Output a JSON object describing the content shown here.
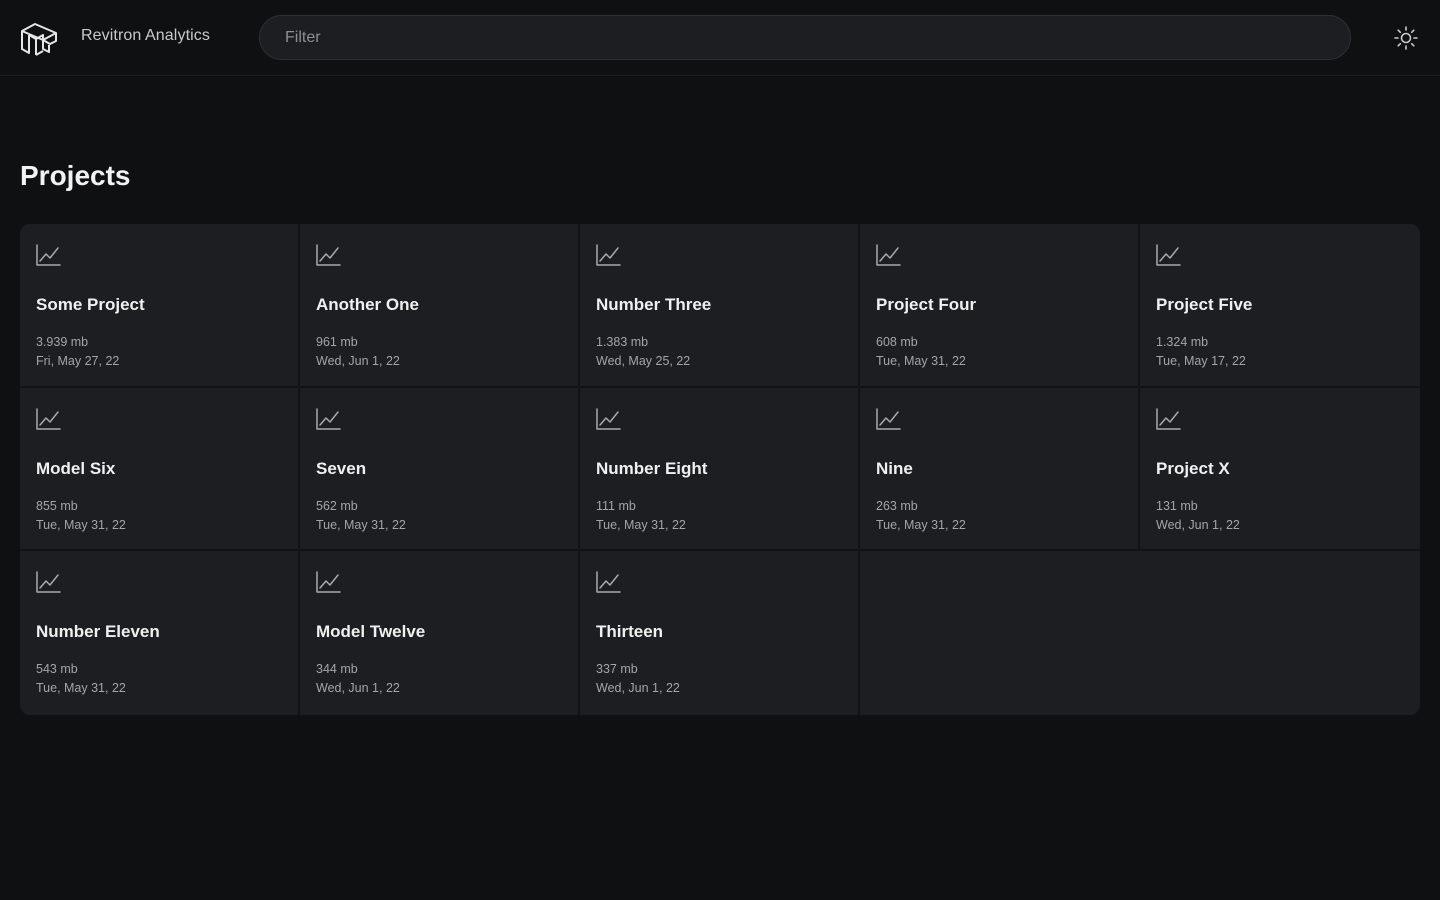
{
  "header": {
    "app_title": "Revitron Analytics",
    "filter_placeholder": "Filter",
    "theme_icon": "sun-icon",
    "logo_icon": "revitron-logo-icon"
  },
  "main": {
    "title": "Projects",
    "card_icon": "line-chart-icon",
    "projects": [
      {
        "title": "Some Project",
        "size": "3.939 mb",
        "date": "Fri, May 27, 22"
      },
      {
        "title": "Another One",
        "size": "961 mb",
        "date": "Wed, Jun 1, 22"
      },
      {
        "title": "Number Three",
        "size": "1.383 mb",
        "date": "Wed, May 25, 22"
      },
      {
        "title": "Project Four",
        "size": "608 mb",
        "date": "Tue, May 31, 22"
      },
      {
        "title": "Project Five",
        "size": "1.324 mb",
        "date": "Tue, May 17, 22"
      },
      {
        "title": "Model Six",
        "size": "855 mb",
        "date": "Tue, May 31, 22"
      },
      {
        "title": "Seven",
        "size": "562 mb",
        "date": "Tue, May 31, 22"
      },
      {
        "title": "Number Eight",
        "size": "111 mb",
        "date": "Tue, May 31, 22"
      },
      {
        "title": "Nine",
        "size": "263 mb",
        "date": "Tue, May 31, 22"
      },
      {
        "title": "Project X",
        "size": "131 mb",
        "date": "Wed, Jun 1, 22"
      },
      {
        "title": "Number Eleven",
        "size": "543 mb",
        "date": "Tue, May 31, 22"
      },
      {
        "title": "Model Twelve",
        "size": "344 mb",
        "date": "Wed, Jun 1, 22"
      },
      {
        "title": "Thirteen",
        "size": "337 mb",
        "date": "Wed, Jun 1, 22"
      }
    ]
  },
  "colors": {
    "background": "#0f1012",
    "card": "#1d1e21",
    "text": "#f0f0f0",
    "muted_text": "#a4a5a9"
  }
}
